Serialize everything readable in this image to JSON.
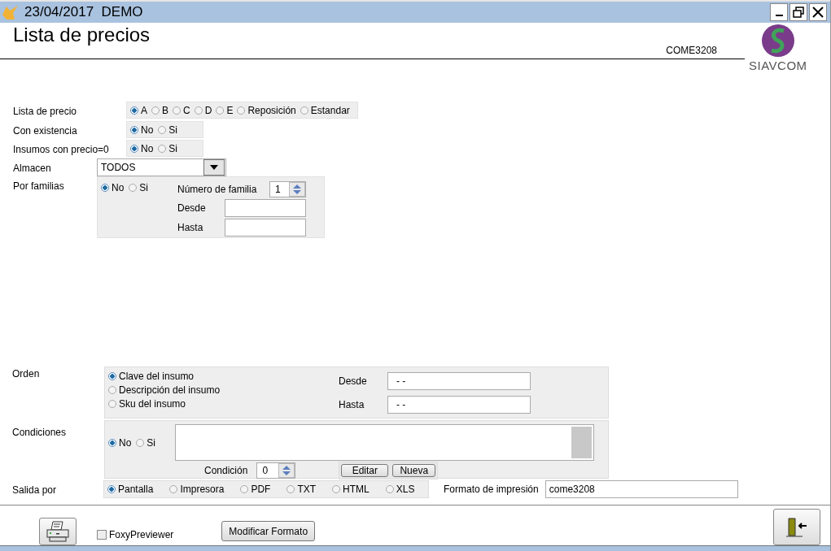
{
  "window": {
    "title": "23/04/2017  DEMO"
  },
  "header": {
    "title": "Lista de precios",
    "code": "COME3208",
    "logo_text": "SIAVCOM"
  },
  "lista_de_precio": {
    "label": "Lista de precio",
    "options": [
      {
        "label": "A",
        "selected": true
      },
      {
        "label": "B",
        "selected": false
      },
      {
        "label": "C",
        "selected": false
      },
      {
        "label": "D",
        "selected": false
      },
      {
        "label": "E",
        "selected": false
      },
      {
        "label": "Reposición",
        "selected": false
      },
      {
        "label": "Estandar",
        "selected": false
      }
    ]
  },
  "con_existencia": {
    "label": "Con existencia",
    "options": [
      {
        "label": "No",
        "selected": true
      },
      {
        "label": "Si",
        "selected": false
      }
    ]
  },
  "insumos_con_precio_cero": {
    "label": "Insumos con precio=0",
    "options": [
      {
        "label": "No",
        "selected": true
      },
      {
        "label": "Si",
        "selected": false
      }
    ]
  },
  "almacen": {
    "label": "Almacen",
    "value": "TODOS"
  },
  "por_familias": {
    "label": "Por familias",
    "options": [
      {
        "label": "No",
        "selected": true
      },
      {
        "label": "Si",
        "selected": false
      }
    ],
    "numero_de_familia": {
      "label": "Número de familia",
      "value": "1"
    },
    "desde": {
      "label": "Desde"
    },
    "hasta": {
      "label": "Hasta"
    }
  },
  "orden": {
    "label": "Orden",
    "options": [
      {
        "label": "Clave del insumo",
        "selected": true
      },
      {
        "label": "Descripción del insumo",
        "selected": false
      },
      {
        "label": "Sku del insumo",
        "selected": false
      }
    ],
    "desde": {
      "label": "Desde",
      "value": "- -"
    },
    "hasta": {
      "label": "Hasta",
      "value": "- -"
    }
  },
  "condiciones": {
    "label": "Condiciones",
    "options": [
      {
        "label": "No",
        "selected": true
      },
      {
        "label": "Si",
        "selected": false
      }
    ],
    "condicion": {
      "label": "Condición",
      "value": "0"
    },
    "buttons": [
      "Editar",
      "Nueva"
    ]
  },
  "salida_por": {
    "label": "Salida por",
    "options": [
      {
        "label": "Pantalla",
        "selected": true
      },
      {
        "label": "Impresora",
        "selected": false
      },
      {
        "label": "PDF",
        "selected": false
      },
      {
        "label": "TXT",
        "selected": false
      },
      {
        "label": "HTML",
        "selected": false
      },
      {
        "label": "XLS",
        "selected": false
      }
    ],
    "formato": {
      "label": "Formato de impresión",
      "value": "come3208"
    }
  },
  "footer": {
    "foxy": {
      "label": "FoxyPreviewer",
      "checked": false
    },
    "modify_button": "Modificar Formato"
  }
}
